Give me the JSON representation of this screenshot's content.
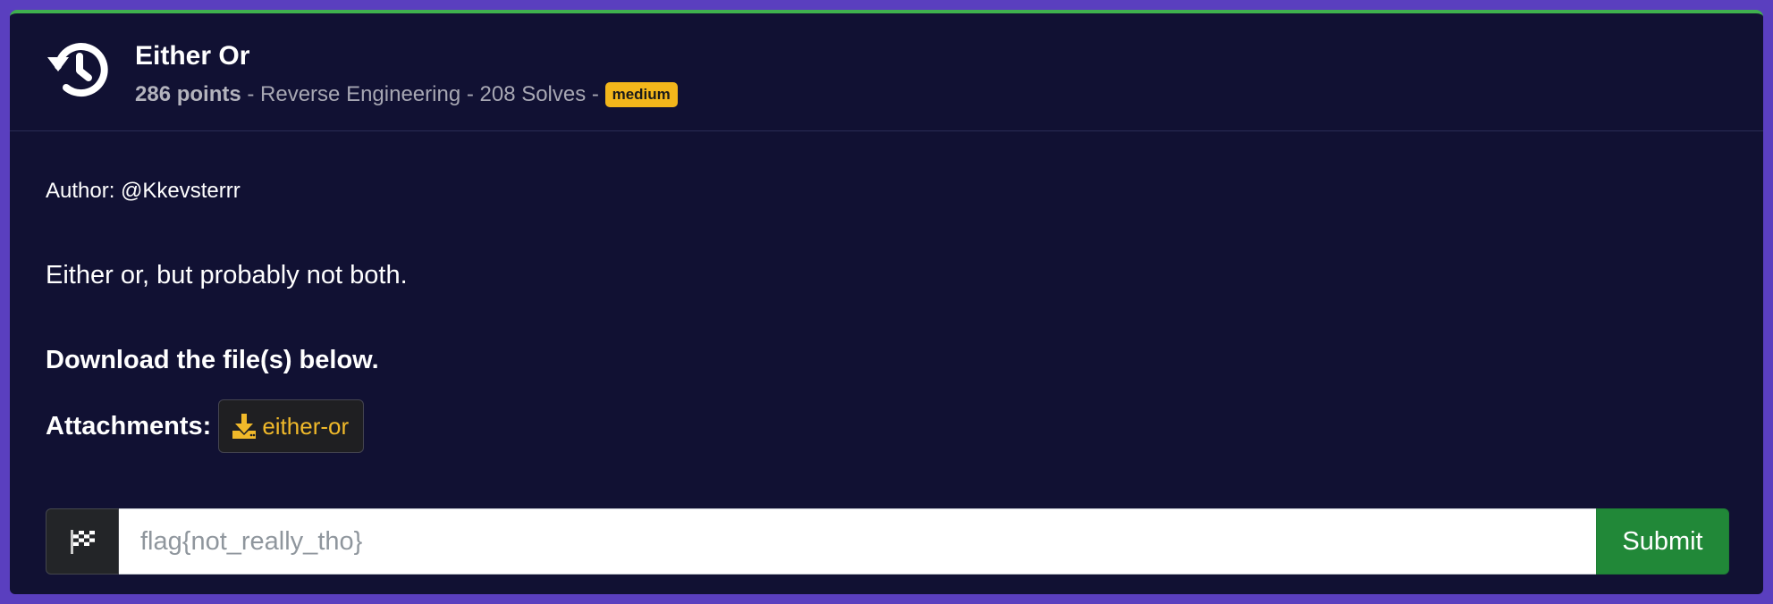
{
  "challenge": {
    "title": "Either Or",
    "points": "286 points",
    "meta_category": " - Reverse Engineering - 208 Solves - ",
    "difficulty": "medium"
  },
  "body": {
    "author": "Author: @Kkevsterrr",
    "description": "Either or, but probably not both.",
    "download_text": "Download the file(s) below.",
    "attachments_label": "Attachments:",
    "attachment_name": "either-or"
  },
  "flag_form": {
    "placeholder": "flag{not_really_tho}",
    "value": "",
    "submit_label": "Submit"
  },
  "colors": {
    "background": "#5a3fbf",
    "card": "#111133",
    "top_accent": "#3fb04e",
    "badge": "#f3b61b",
    "attachment_text": "#f0b92a",
    "submit": "#218838"
  },
  "icons": {
    "header": "history-icon",
    "attachment": "download-icon",
    "flag_addon": "checkered-flag-icon"
  }
}
